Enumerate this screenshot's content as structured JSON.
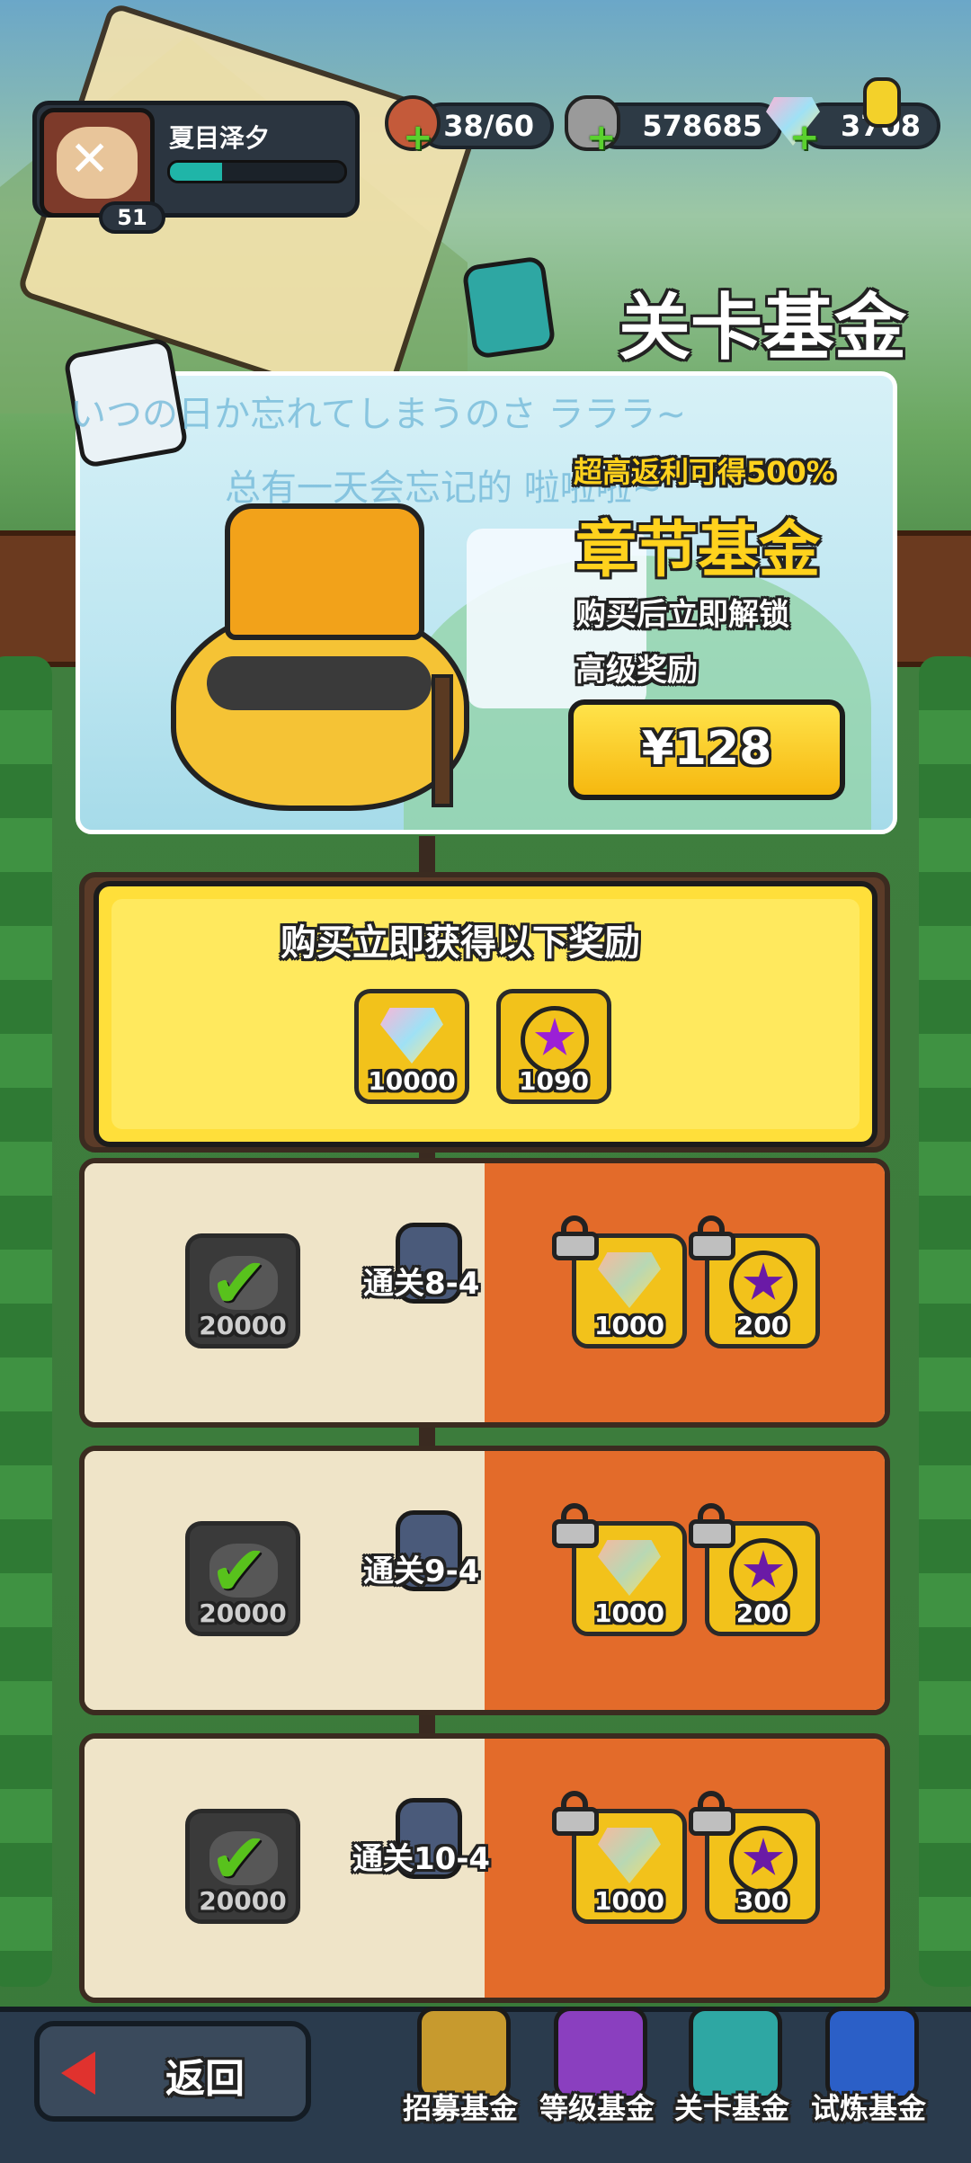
{
  "player": {
    "name": "夏目泽夕",
    "level": "51"
  },
  "resources": {
    "stamina": "38/60",
    "coins": "578685",
    "gems": "3708"
  },
  "page_title": "关卡基金",
  "lyrics": {
    "line1": "いつの日か忘れてしまうのさ ラララ~",
    "line2": "总有一天会忘记的 啦啦啦~"
  },
  "banner": {
    "tagline": "超高返利可得500%",
    "title": "章节基金",
    "desc1": "购买后立即解锁",
    "desc2": "高级奖励",
    "price": "¥128"
  },
  "instant_rewards": {
    "title": "购买立即获得以下奖励",
    "items": [
      {
        "icon": "diamond-icon",
        "qty": "10000"
      },
      {
        "icon": "star-coin-icon",
        "qty": "1090"
      }
    ]
  },
  "fund_rows": [
    {
      "stage": "通关8-4",
      "free": {
        "icon": "rock-icon",
        "qty": "20000"
      },
      "premium": [
        {
          "icon": "diamond-icon",
          "qty": "1000"
        },
        {
          "icon": "star-coin-icon",
          "qty": "200"
        }
      ]
    },
    {
      "stage": "通关9-4",
      "free": {
        "icon": "rock-icon",
        "qty": "20000"
      },
      "premium": [
        {
          "icon": "diamond-icon",
          "qty": "1000"
        },
        {
          "icon": "star-coin-icon",
          "qty": "200"
        }
      ]
    },
    {
      "stage": "通关10-4",
      "free": {
        "icon": "rock-icon",
        "qty": "20000"
      },
      "premium": [
        {
          "icon": "diamond-icon",
          "qty": "1000"
        },
        {
          "icon": "star-coin-icon",
          "qty": "300"
        }
      ]
    }
  ],
  "bottom": {
    "back": "返回",
    "tabs": [
      "招募基金",
      "等级基金",
      "关卡基金",
      "试炼基金"
    ],
    "tab_icons": [
      "recruit-fund-icon",
      "level-fund-icon",
      "stage-fund-icon",
      "trial-fund-icon"
    ],
    "active_tab": "关卡基金"
  },
  "colors": {
    "accent_yellow": "#ffd21d",
    "premium_orange": "#e36b2a",
    "check_green": "#58c21c",
    "star_purple": "#9b1fd6"
  }
}
